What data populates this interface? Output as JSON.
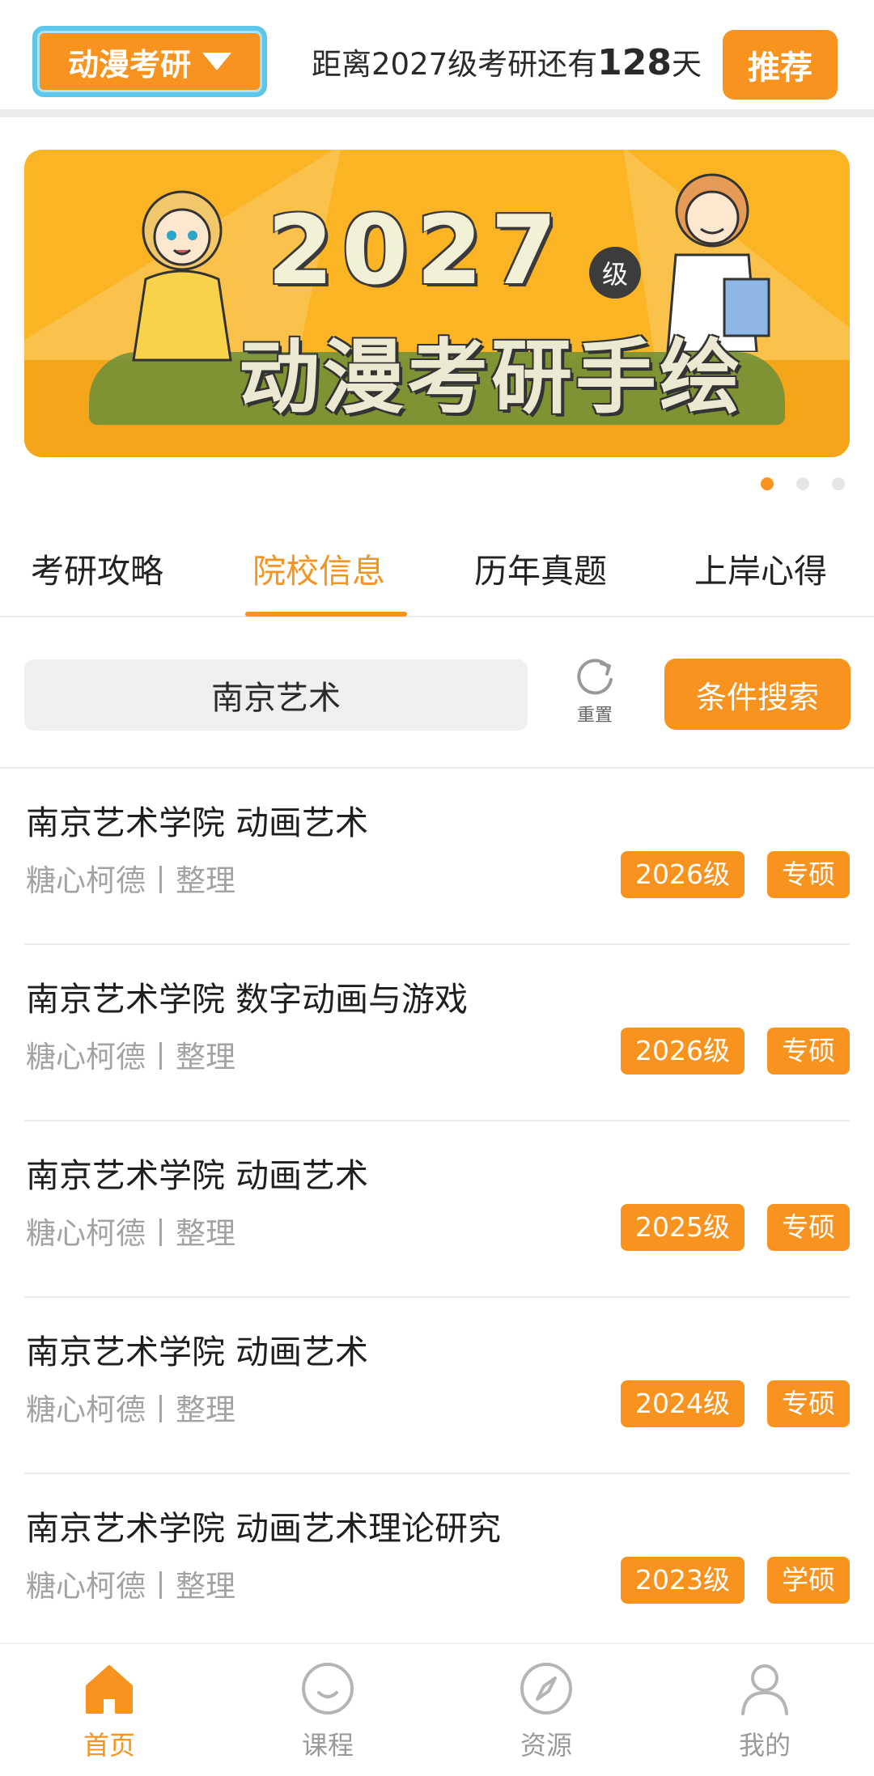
{
  "header": {
    "app_switch_label": "动漫考研",
    "countdown_prefix": "距离2027级考研还有",
    "countdown_days": "128",
    "countdown_suffix": "天",
    "recommend_label": "推荐"
  },
  "banner": {
    "year_text": "2027",
    "grade_badge": "级",
    "slogan": "动漫考研手绘",
    "slide_count": 3,
    "active_slide": 1
  },
  "tabs": [
    {
      "label": "考研攻略",
      "active": false
    },
    {
      "label": "院校信息",
      "active": true
    },
    {
      "label": "历年真题",
      "active": false
    },
    {
      "label": "上岸心得",
      "active": false
    }
  ],
  "search": {
    "value": "南京艺术",
    "reset_label": "重置",
    "filter_label": "条件搜索"
  },
  "results": [
    {
      "title": "南京艺术学院 动画艺术",
      "meta": "糖心柯德丨整理",
      "year": "2026级",
      "degree": "专硕"
    },
    {
      "title": "南京艺术学院 数字动画与游戏",
      "meta": "糖心柯德丨整理",
      "year": "2026级",
      "degree": "专硕"
    },
    {
      "title": "南京艺术学院 动画艺术",
      "meta": "糖心柯德丨整理",
      "year": "2025级",
      "degree": "专硕"
    },
    {
      "title": "南京艺术学院 动画艺术",
      "meta": "糖心柯德丨整理",
      "year": "2024级",
      "degree": "专硕"
    },
    {
      "title": "南京艺术学院  动画艺术理论研究",
      "meta": "糖心柯德丨整理",
      "year": "2023级",
      "degree": "学硕"
    }
  ],
  "tabbar": [
    {
      "label": "首页",
      "icon": "home-icon",
      "active": true
    },
    {
      "label": "课程",
      "icon": "course-smile-icon",
      "active": false
    },
    {
      "label": "资源",
      "icon": "compass-icon",
      "active": false
    },
    {
      "label": "我的",
      "icon": "user-icon",
      "active": false
    }
  ],
  "colors": {
    "accent": "#f7931e",
    "switch_border": "#5cc7ea",
    "muted_text": "#a3a3a3",
    "banner_bg": "#fbb524"
  }
}
